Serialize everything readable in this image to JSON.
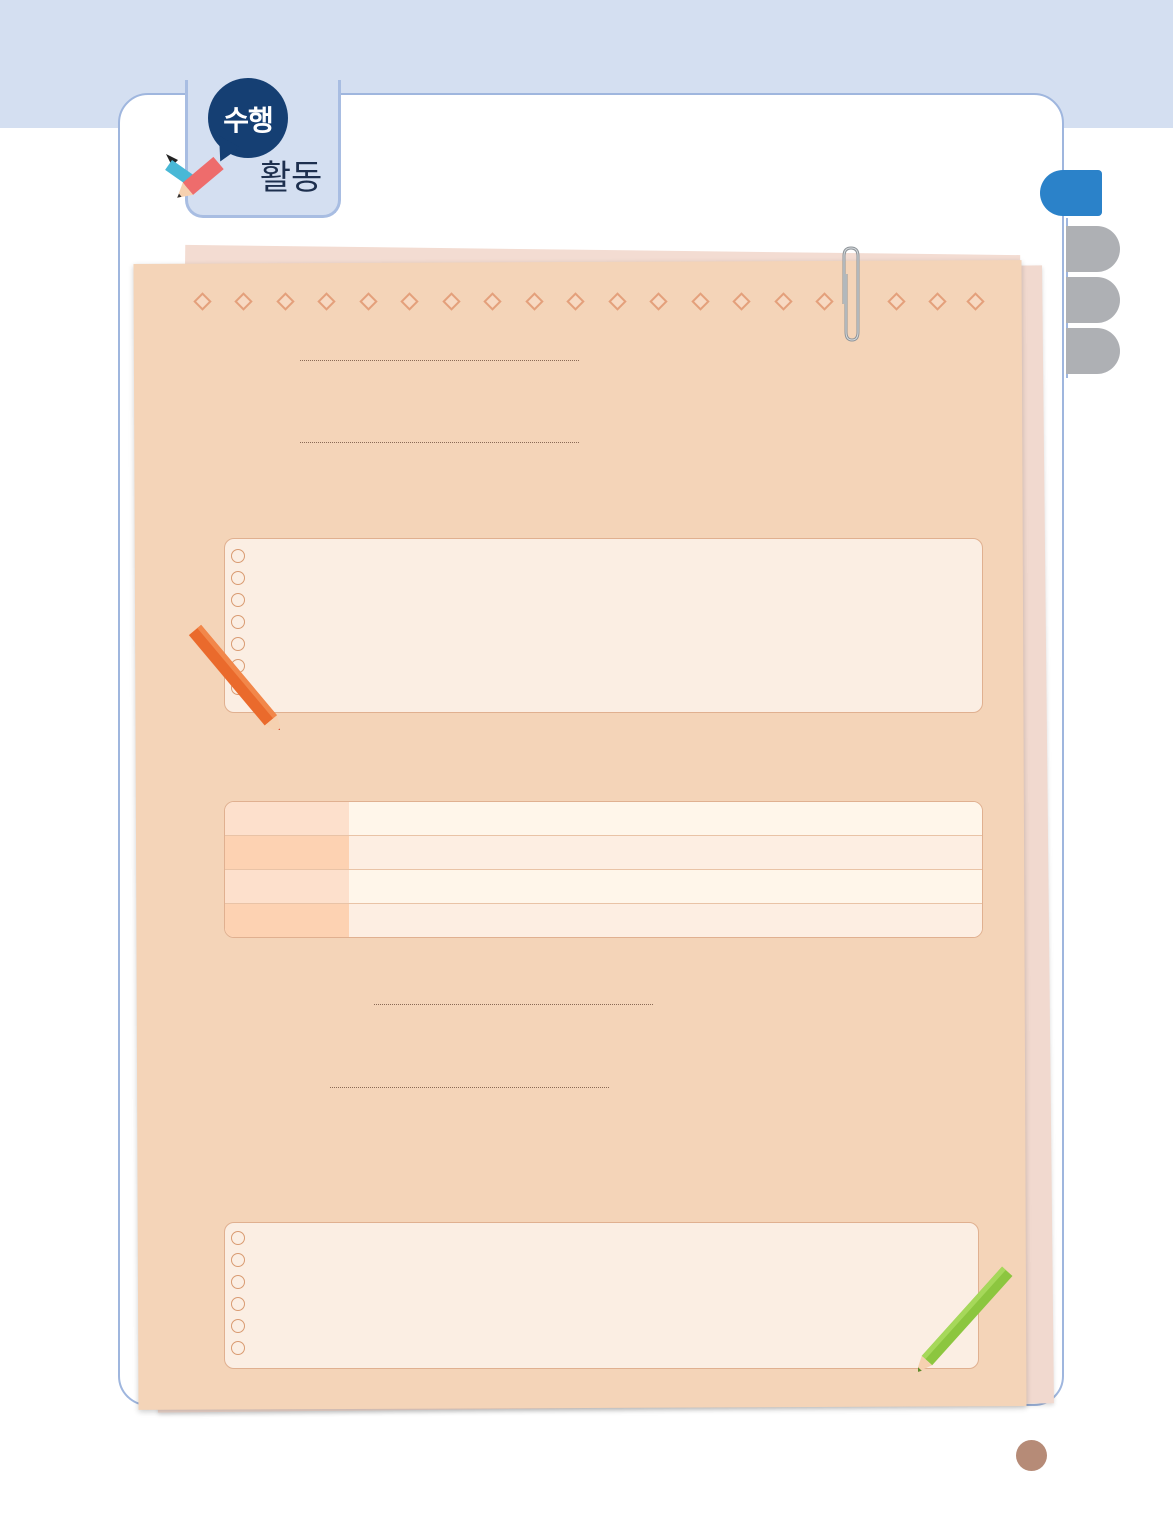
{
  "header": {
    "badge_line1": "수행",
    "badge_line2": "활동"
  },
  "colors": {
    "band": "#d4dff1",
    "frame_border": "#9fb6de",
    "badge": "#153f73",
    "active_side_tab": "#2b82c9",
    "inactive_side_tab": "#aeb0b4",
    "paper": "#f4d4b8",
    "page_marker": "#b68b77"
  },
  "side_tabs": [
    "active",
    "inactive",
    "inactive",
    "inactive"
  ],
  "worksheet": {
    "table_rows": 4
  }
}
